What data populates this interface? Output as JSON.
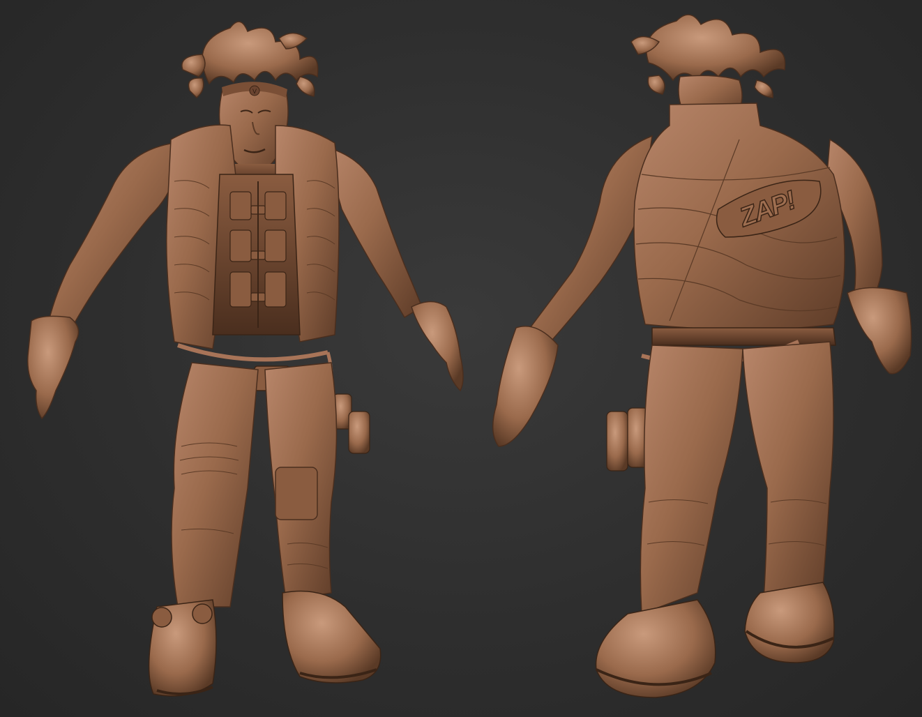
{
  "scene": {
    "background_color": "#2f2f2f",
    "clay_color": "#9a6a4c"
  },
  "figures": [
    {
      "view": "front",
      "headband_symbol": "V"
    },
    {
      "view": "back",
      "vest_lettering": "ZAP!"
    }
  ]
}
